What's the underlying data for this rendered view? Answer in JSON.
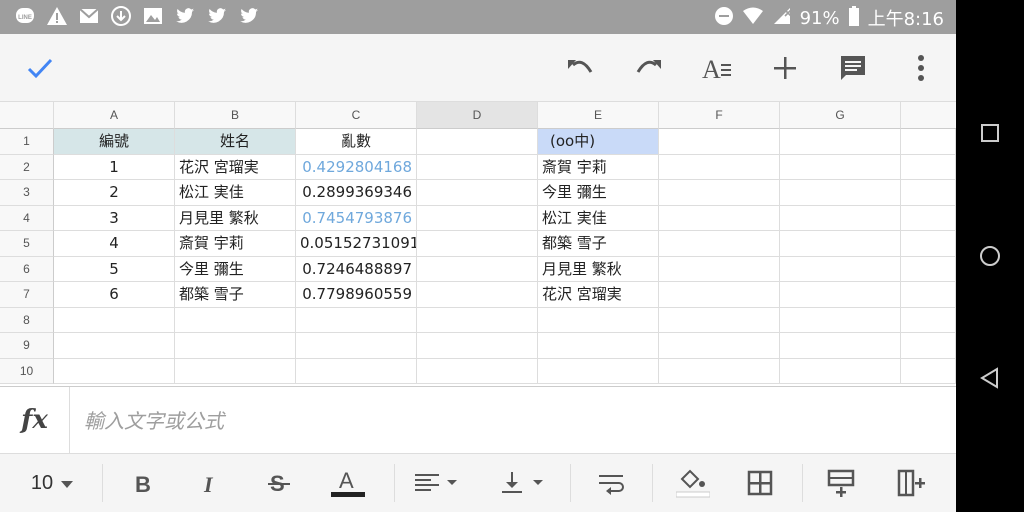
{
  "status_bar": {
    "icons_left": [
      "line-icon",
      "warning-icon",
      "gmail-icon",
      "download-icon",
      "image-icon",
      "twitter-icon",
      "twitter-icon",
      "twitter-icon"
    ],
    "battery": "91%",
    "time": "上午8:16"
  },
  "toolbar": {
    "confirm_icon": "check-icon",
    "actions": [
      "undo-icon",
      "redo-icon",
      "text-format-icon",
      "add-icon",
      "comment-icon",
      "more-icon"
    ]
  },
  "sheet": {
    "columns": [
      "A",
      "B",
      "C",
      "D",
      "E",
      "F",
      "G"
    ],
    "rows": [
      "1",
      "2",
      "3",
      "4",
      "5",
      "6",
      "7",
      "8",
      "9",
      "10"
    ],
    "cells": {
      "A1": "編號",
      "B1": "姓名",
      "C1": "亂數",
      "E1": "(oo中)",
      "A2": "1",
      "B2": "花沢 宮瑠実",
      "C2": "0.4292804168",
      "E2": "斎賀 宇莉",
      "A3": "2",
      "B3": "松江 実佳",
      "C3": "0.2899369346",
      "E3": "今里 彌生",
      "A4": "3",
      "B4": "月見里 繁秋",
      "C4": "0.7454793876",
      "E4": "松江 実佳",
      "A5": "4",
      "B5": "斎賀 宇莉",
      "C5": "0.05152731091",
      "E5": "都築 雪子",
      "A6": "5",
      "B6": "今里 彌生",
      "C6": "0.7246488897",
      "E6": "月見里 繁秋",
      "A7": "6",
      "B7": "都築 雪子",
      "C7": "0.7798960559",
      "E7": "花沢 宮瑠実"
    }
  },
  "formula_bar": {
    "fx_label": "fx",
    "placeholder": "輸入文字或公式"
  },
  "format_bar": {
    "font_size": "10",
    "buttons": [
      "bold-icon",
      "italic-icon",
      "strikethrough-icon",
      "text-color-icon",
      "align-icon",
      "vertical-align-icon",
      "wrap-icon",
      "fill-color-icon",
      "borders-icon",
      "insert-row-icon",
      "insert-column-icon"
    ]
  },
  "nav_bar": [
    "recents-button",
    "home-button",
    "back-button"
  ],
  "colors": {
    "accent": "#4285f4",
    "header_teal": "#d6e6e8",
    "header_blue": "#c9daf8",
    "highlight_text": "#6fa8dc"
  }
}
